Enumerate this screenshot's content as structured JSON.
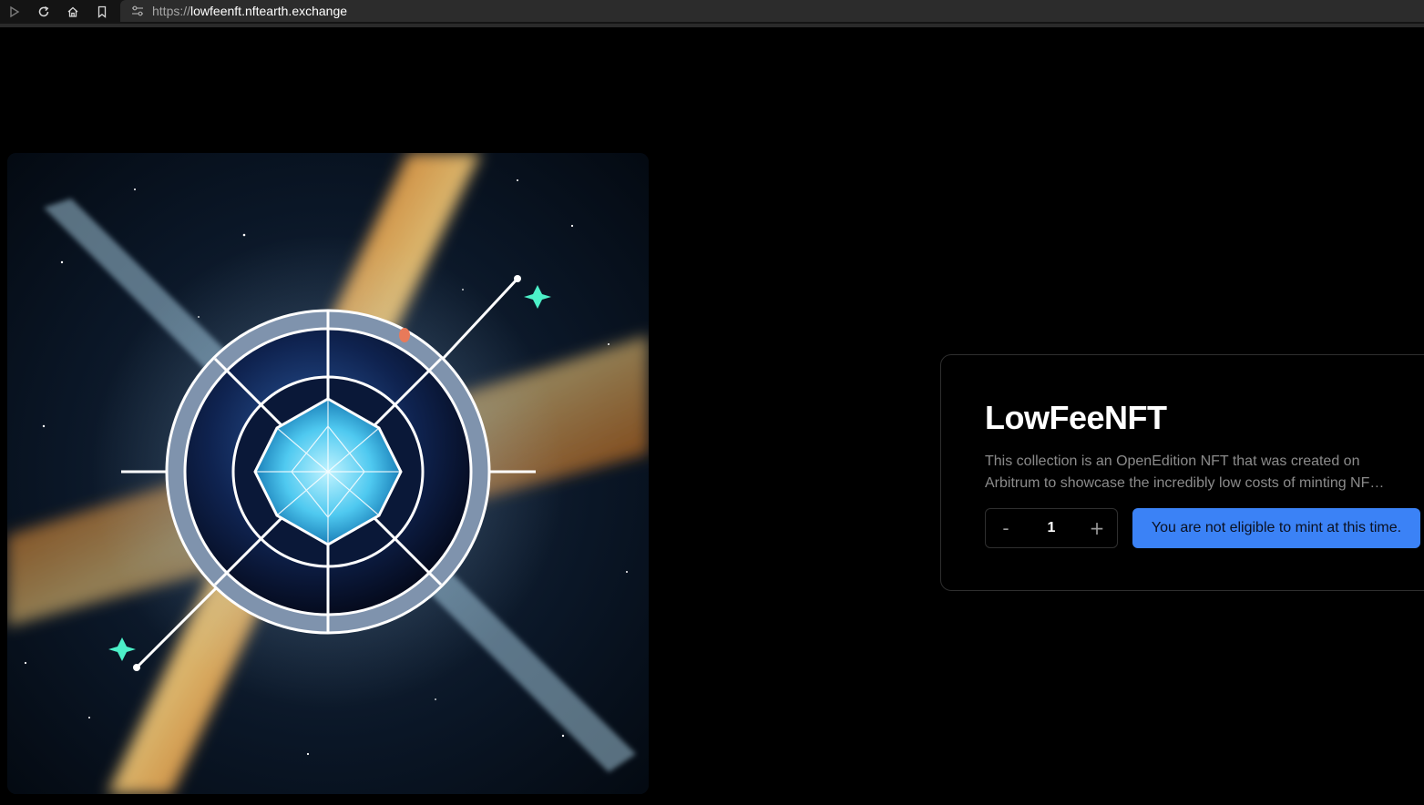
{
  "browser": {
    "url_scheme": "https://",
    "url_host": "lowfeenft.nftearth.exchange",
    "nav_icons": [
      "play-icon",
      "reload-icon",
      "home-icon",
      "bookmark-icon"
    ]
  },
  "artwork": {
    "icon": "nft-artwork-image",
    "colors": {
      "space": "#06101c",
      "nebula": "#ff8a1e",
      "ring": "#7f93ad",
      "core": "#4fc9f0",
      "sparkle": "#4cf0c8"
    }
  },
  "mint_card": {
    "title": "LowFeeNFT",
    "description": "This collection is an OpenEdition NFT that was created on Arbitrum to showcase the incredibly low costs of minting NFTs on Arbitrum.",
    "quantity": {
      "decrement_label": "-",
      "value": "1",
      "increment_label": "+"
    },
    "mint_button_label": "You are not eligible to mint at this time.",
    "accent_color": "#3b82f6"
  }
}
